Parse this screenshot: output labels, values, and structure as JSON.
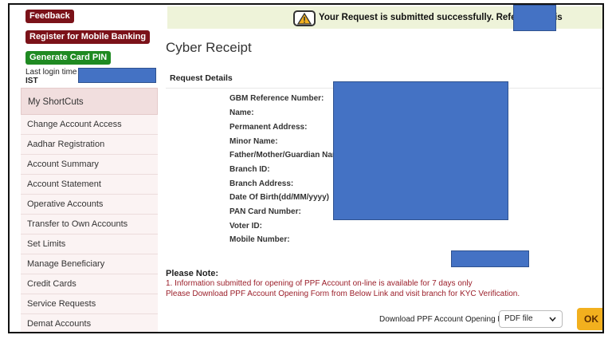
{
  "sidebar": {
    "feedback_label": "Feedback",
    "register_label": "Register for Mobile Banking",
    "card_pin_label": "Generate Card PIN",
    "last_login_label": "Last login time :",
    "last_login_tz": "IST",
    "menu": [
      {
        "label": "My ShortCuts"
      },
      {
        "label": "Change Account Access"
      },
      {
        "label": "Aadhar Registration"
      },
      {
        "label": "Account Summary"
      },
      {
        "label": "Account Statement"
      },
      {
        "label": "Operative Accounts"
      },
      {
        "label": "Transfer to Own Accounts"
      },
      {
        "label": "Set Limits"
      },
      {
        "label": "Manage Beneficiary"
      },
      {
        "label": "Credit Cards"
      },
      {
        "label": "Service Requests"
      },
      {
        "label": "Demat Accounts"
      }
    ]
  },
  "banner": {
    "message": "Your Request is submitted successfully. Reference ID is",
    "icon": "warning-icon"
  },
  "main": {
    "title": "Cyber Receipt",
    "section_title": "Request Details",
    "fields": [
      {
        "label": "GBM Reference Number:"
      },
      {
        "label": "Name:"
      },
      {
        "label": "Permanent Address:"
      },
      {
        "label": "Minor Name:"
      },
      {
        "label": "Father/Mother/Guardian Name:"
      },
      {
        "label": "Branch ID:"
      },
      {
        "label": "Branch Address:"
      },
      {
        "label": "Date Of Birth(dd/MM/yyyy)"
      },
      {
        "label": "PAN Card Number:"
      },
      {
        "label": "Voter ID:"
      },
      {
        "label": "Mobile Number:"
      }
    ],
    "note_title": "Please Note:",
    "note_lines": [
      "1. Information submitted for opening of PPF Account on-line is available for 7 days only",
      "Please Download PPF Account Opening Form from Below Link and visit branch for KYC Verification."
    ],
    "download_label": "Download PPF Account Opening Form:",
    "download_select_value": "PDF file",
    "ok_label": "OK"
  },
  "colors": {
    "maroon": "#7b1219",
    "green": "#1f8a22",
    "redaction": "#4472c4",
    "banner_bg": "#eef3d9",
    "note_text": "#9b1f2a",
    "ok_button": "#f2b01e"
  }
}
